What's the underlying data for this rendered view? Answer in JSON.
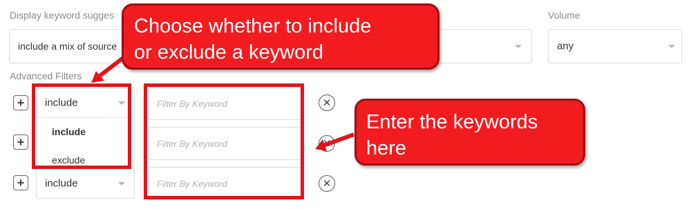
{
  "labels": {
    "display_keyword_suggestions": "Display keyword sugges",
    "volume": "Volume",
    "advanced_filters": "Advanced Filters"
  },
  "selects": {
    "suggestions_value": "include a mix of source",
    "volume_value": "any"
  },
  "filter_rows": [
    {
      "mode": "include",
      "keyword_placeholder": "Filter By Keyword"
    },
    {
      "mode": "",
      "keyword_placeholder": "Filter By Keyword"
    },
    {
      "mode": "include",
      "keyword_placeholder": "Filter By Keyword"
    }
  ],
  "mode_dropdown": {
    "options": [
      "include",
      "exclude"
    ],
    "selected": "include"
  },
  "annotations": {
    "callout_mode_line1": "Choose whether to include",
    "callout_mode_line2": "or exclude a keyword",
    "callout_keywords_line1": "Enter the keywords",
    "callout_keywords_line2": "here"
  },
  "icons": {
    "add": "plus-square-icon",
    "remove": "circle-x-icon",
    "dropdown": "chevron-down-icon"
  },
  "colors": {
    "annotation_red": "#f21c1f",
    "annotation_border": "#9d0f12",
    "frame_red": "#e0161a"
  }
}
